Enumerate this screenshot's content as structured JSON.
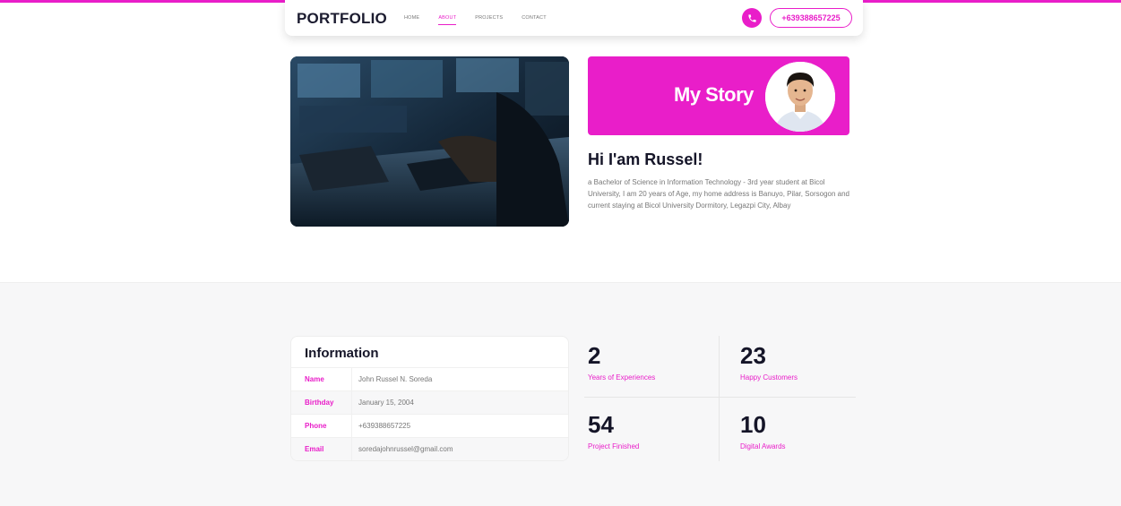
{
  "header": {
    "brand": "PORTFOLIO",
    "nav": [
      "HOME",
      "ABOUT",
      "PROJECTS",
      "CONTACT"
    ],
    "active_nav": "ABOUT",
    "phone": "+639388657225",
    "phone_icon": "phone-icon"
  },
  "story": {
    "banner_title": "My Story",
    "greeting": "Hi I'am Russel!",
    "bio": "a Bachelor of Science in Information Technology - 3rd year student at Bicol University, I am 20 years of Age, my home address is Banuyo, Pilar, Sorsogon and current staying at Bicol University Dormitory, Legazpi City, Albay"
  },
  "information": {
    "title": "Information",
    "rows": [
      {
        "key": "Name",
        "value": "John Russel N. Soreda"
      },
      {
        "key": "Birthday",
        "value": "January 15, 2004"
      },
      {
        "key": "Phone",
        "value": "+639388657225"
      },
      {
        "key": "Email",
        "value": "soredajohnrussel@gmail.com"
      }
    ]
  },
  "stats": [
    {
      "number": "2",
      "label": "Years of Experiences"
    },
    {
      "number": "23",
      "label": "Happy Customers"
    },
    {
      "number": "54",
      "label": "Project Finished"
    },
    {
      "number": "10",
      "label": "Digital Awards"
    }
  ],
  "colors": {
    "accent": "#e91ec9",
    "text_dark": "#151528",
    "muted": "#777777"
  }
}
